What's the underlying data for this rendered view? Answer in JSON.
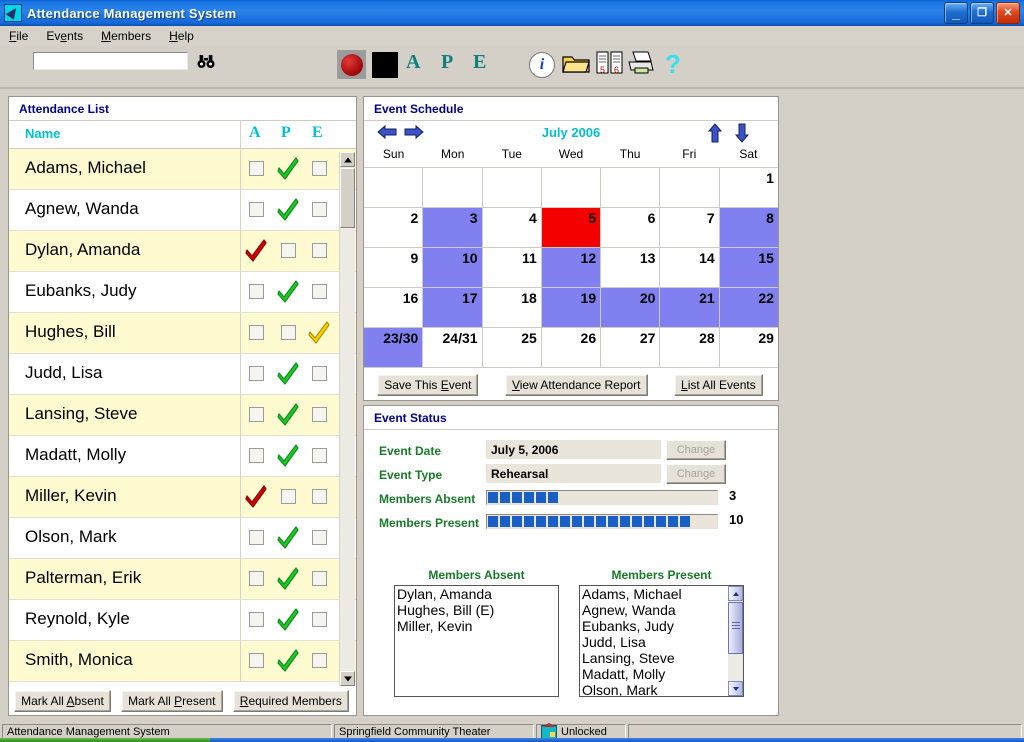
{
  "window": {
    "title": "Attendance Management System",
    "icon": "app-icon",
    "buttons": {
      "minimize": "_",
      "restore": "❐",
      "close": "✕"
    }
  },
  "menubar": {
    "items": [
      {
        "label": "File",
        "accel_index": 0
      },
      {
        "label": "Events",
        "accel_index": 2
      },
      {
        "label": "Members",
        "accel_index": 0
      },
      {
        "label": "Help",
        "accel_index": 0
      }
    ]
  },
  "toolbar": {
    "search_value": "",
    "search_placeholder": "",
    "find_icon": "binoculars-icon",
    "record_icon": "record-red-circle-icon",
    "stop_icon": "stop-black-square-icon",
    "letters": [
      "A",
      "P",
      "E"
    ],
    "info_icon": "info-icon",
    "info_glyph": "i",
    "open_icon": "open-folder-icon",
    "list_icon": "list-pages-icon",
    "list_numbers": [
      "5",
      "6"
    ],
    "print_icon": "printer-icon",
    "help_icon": "help-question-icon",
    "help_glyph": "?"
  },
  "attendance": {
    "panel_title": "Attendance List",
    "name_header": "Name",
    "columns": [
      "A",
      "P",
      "E"
    ],
    "rows": [
      {
        "name": "Adams, Michael",
        "mark": "P"
      },
      {
        "name": "Agnew, Wanda",
        "mark": "P"
      },
      {
        "name": "Dylan, Amanda",
        "mark": "A"
      },
      {
        "name": "Eubanks, Judy",
        "mark": "P"
      },
      {
        "name": "Hughes, Bill",
        "mark": "E"
      },
      {
        "name": "Judd, Lisa",
        "mark": "P"
      },
      {
        "name": "Lansing, Steve",
        "mark": "P"
      },
      {
        "name": "Madatt, Molly",
        "mark": "P"
      },
      {
        "name": "Miller, Kevin",
        "mark": "A"
      },
      {
        "name": "Olson, Mark",
        "mark": "P"
      },
      {
        "name": "Palterman, Erik",
        "mark": "P"
      },
      {
        "name": "Reynold, Kyle",
        "mark": "P"
      },
      {
        "name": "Smith, Monica",
        "mark": "P"
      }
    ],
    "buttons": [
      {
        "label": "Mark All Absent",
        "accel_index": 9
      },
      {
        "label": "Mark All Present",
        "accel_index": 9
      },
      {
        "label": "Required Members",
        "accel_index": 0
      }
    ],
    "scroll": {
      "up_icon": "scroll-up-arrow-icon",
      "down_icon": "scroll-down-arrow-icon"
    }
  },
  "schedule": {
    "panel_title": "Event Schedule",
    "month_label": "July 2006",
    "prev_icon": "arrow-left-icon",
    "next_icon": "arrow-right-icon",
    "year_up_icon": "arrow-up-icon",
    "year_down_icon": "arrow-down-icon",
    "day_headers": [
      "Sun",
      "Mon",
      "Tue",
      "Wed",
      "Thu",
      "Fri",
      "Sat"
    ],
    "weeks": [
      [
        {
          "label": "",
          "state": "empty"
        },
        {
          "label": "",
          "state": "empty"
        },
        {
          "label": "",
          "state": "empty"
        },
        {
          "label": "",
          "state": "empty"
        },
        {
          "label": "",
          "state": "empty"
        },
        {
          "label": "",
          "state": "empty"
        },
        {
          "label": "1",
          "state": "none"
        }
      ],
      [
        {
          "label": "2",
          "state": "none"
        },
        {
          "label": "3",
          "state": "event"
        },
        {
          "label": "4",
          "state": "none"
        },
        {
          "label": "5",
          "state": "selected"
        },
        {
          "label": "6",
          "state": "none"
        },
        {
          "label": "7",
          "state": "none"
        },
        {
          "label": "8",
          "state": "event"
        }
      ],
      [
        {
          "label": "9",
          "state": "none"
        },
        {
          "label": "10",
          "state": "event"
        },
        {
          "label": "11",
          "state": "none"
        },
        {
          "label": "12",
          "state": "event"
        },
        {
          "label": "13",
          "state": "none"
        },
        {
          "label": "14",
          "state": "none"
        },
        {
          "label": "15",
          "state": "event"
        }
      ],
      [
        {
          "label": "16",
          "state": "none"
        },
        {
          "label": "17",
          "state": "event"
        },
        {
          "label": "18",
          "state": "none"
        },
        {
          "label": "19",
          "state": "event"
        },
        {
          "label": "20",
          "state": "event"
        },
        {
          "label": "21",
          "state": "event"
        },
        {
          "label": "22",
          "state": "event"
        }
      ],
      [
        {
          "label": "23/30",
          "state": "event"
        },
        {
          "label": "24/31",
          "state": "none"
        },
        {
          "label": "25",
          "state": "none"
        },
        {
          "label": "26",
          "state": "none"
        },
        {
          "label": "27",
          "state": "none"
        },
        {
          "label": "28",
          "state": "none"
        },
        {
          "label": "29",
          "state": "none"
        }
      ]
    ],
    "buttons": [
      {
        "label": "Save This Event",
        "accel_index": 10
      },
      {
        "label": "View Attendance Report",
        "accel_index": 0
      },
      {
        "label": "List All Events",
        "accel_index": 0
      }
    ],
    "colors": {
      "event": "#8080f0",
      "selected": "#f50000",
      "month_text": "#00bfd0"
    }
  },
  "status": {
    "panel_title": "Event Status",
    "event_date_label": "Event Date",
    "event_date_value": "July 5, 2006",
    "event_type_label": "Event Type",
    "event_type_value": "Rehearsal",
    "change_label": "Change",
    "absent_label": "Members Absent",
    "absent_count": "3",
    "absent_segments": 6,
    "present_label": "Members Present",
    "present_count": "10",
    "present_segments": 17,
    "absent_list_title": "Members Absent",
    "absent_list": [
      "Dylan, Amanda",
      "Hughes, Bill (E)",
      "Miller, Kevin"
    ],
    "present_list_title": "Members Present",
    "present_list": [
      "Adams, Michael",
      "Agnew, Wanda",
      "Eubanks, Judy",
      "Judd, Lisa",
      "Lansing, Steve",
      "Madatt, Molly",
      "Olson, Mark"
    ]
  },
  "statusbar": {
    "app_name": "Attendance Management System",
    "organization": "Springfield Community Theater",
    "lock_state": "Unlocked",
    "lock_icon": "unlocked-icon"
  }
}
